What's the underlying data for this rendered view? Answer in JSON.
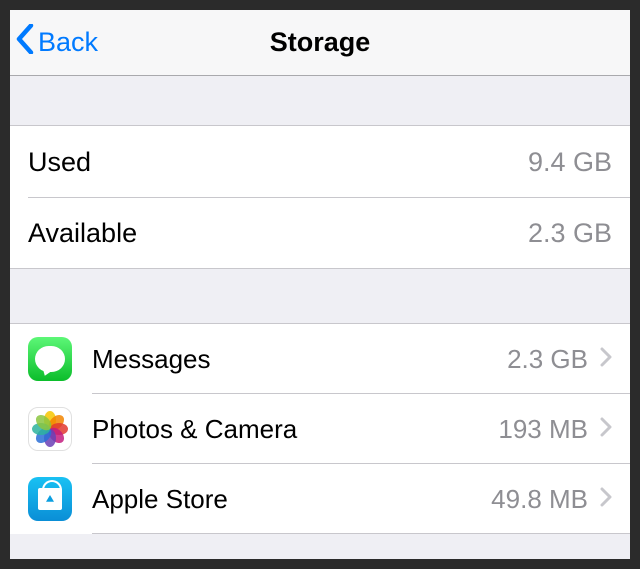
{
  "header": {
    "back_label": "Back",
    "title": "Storage"
  },
  "summary": [
    {
      "label": "Used",
      "value": "9.4 GB"
    },
    {
      "label": "Available",
      "value": "2.3 GB"
    }
  ],
  "apps": [
    {
      "icon": "messages-icon",
      "label": "Messages",
      "value": "2.3 GB"
    },
    {
      "icon": "photos-icon",
      "label": "Photos & Camera",
      "value": "193 MB"
    },
    {
      "icon": "app-store-icon",
      "label": "Apple Store",
      "value": "49.8 MB"
    }
  ]
}
